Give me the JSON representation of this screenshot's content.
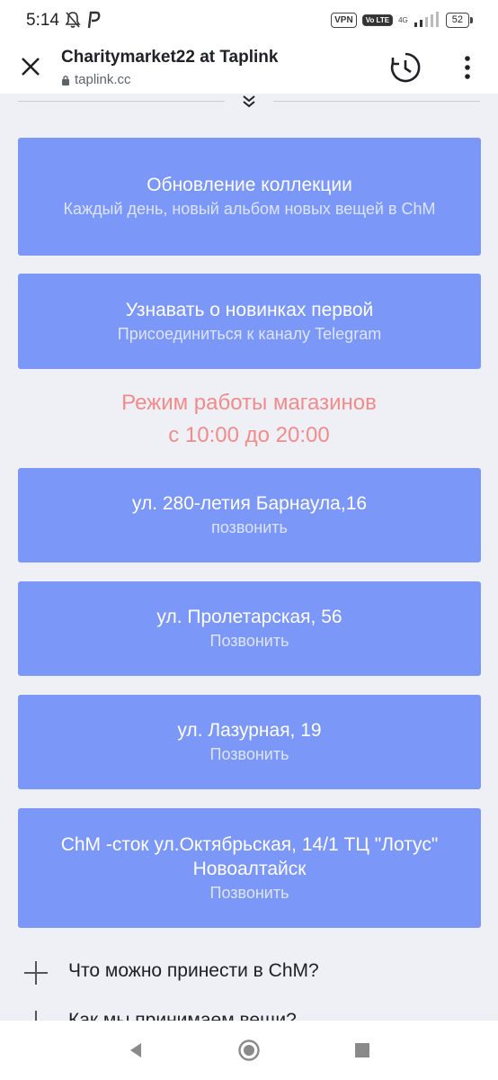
{
  "status": {
    "time": "5:14",
    "vpn": "VPN",
    "volte": "Vo LTE",
    "network": "4G",
    "battery": "52"
  },
  "app_bar": {
    "title": "Charitymarket22 at Taplink",
    "url": "taplink.cc"
  },
  "cards": [
    {
      "title": "Обновление коллекции",
      "subtitle": "Каждый день, новый альбом новых вещей в ChM"
    },
    {
      "title": "Узнавать о новинках первой",
      "subtitle": "Присоединиться к каналу Telegram"
    }
  ],
  "hours": {
    "line1": "Режим работы магазинов",
    "line2": "с 10:00 до 20:00"
  },
  "stores": [
    {
      "title": "ул. 280-летия Барнаула,16",
      "action": "позвонить"
    },
    {
      "title": "ул. Пролетарская, 56",
      "action": "Позвонить"
    },
    {
      "title": "ул. Лазурная, 19",
      "action": "Позвонить"
    },
    {
      "title": "ChM -сток ул.Октябрьская, 14/1 ТЦ \"Лотус\" Новоалтайск",
      "action": "Позвонить"
    }
  ],
  "faq": [
    {
      "label": "Что можно принести в ChM?"
    },
    {
      "label": "Как мы принимаем вещи?"
    }
  ],
  "colors": {
    "card": "#7b97f7",
    "hours_text": "#f08c8c",
    "background": "#eef0f6"
  }
}
